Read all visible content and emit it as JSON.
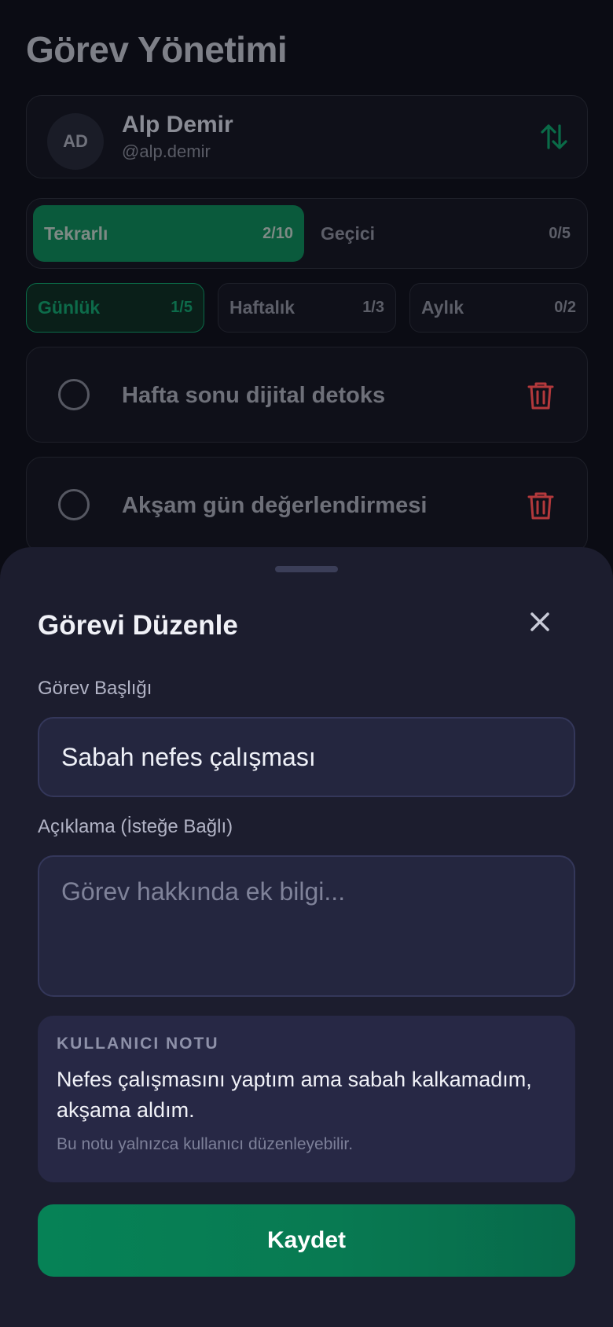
{
  "header": {
    "title": "Görev Yönetimi"
  },
  "user": {
    "initials": "AD",
    "name": "Alp Demir",
    "handle": "@alp.demir"
  },
  "type_tabs": [
    {
      "label": "Tekrarlı",
      "count": "2/10",
      "active": true
    },
    {
      "label": "Geçici",
      "count": "0/5",
      "active": false
    }
  ],
  "period_tabs": [
    {
      "label": "Günlük",
      "count": "1/5",
      "active": true
    },
    {
      "label": "Haftalık",
      "count": "1/3",
      "active": false
    },
    {
      "label": "Aylık",
      "count": "0/2",
      "active": false
    }
  ],
  "tasks": [
    {
      "title": "Hafta sonu dijital detoks"
    },
    {
      "title": "Akşam gün değerlendirmesi"
    }
  ],
  "sheet": {
    "title": "Görevi Düzenle",
    "title_label": "Görev Başlığı",
    "title_value": "Sabah nefes çalışması",
    "desc_label": "Açıklama (İsteğe Bağlı)",
    "desc_placeholder": "Görev hakkında ek bilgi...",
    "note_label": "KULLANICI NOTU",
    "note_text": "Nefes çalışmasını yaptım ama sabah kalkamadım, akşama aldım.",
    "note_hint": "Bu notu yalnızca kullanıcı düzenleyebilir.",
    "save_label": "Kaydet"
  },
  "colors": {
    "accent": "#068256",
    "danger": "#d63a3a",
    "background": "#0b0c14",
    "sheet": "#1c1d2e"
  }
}
